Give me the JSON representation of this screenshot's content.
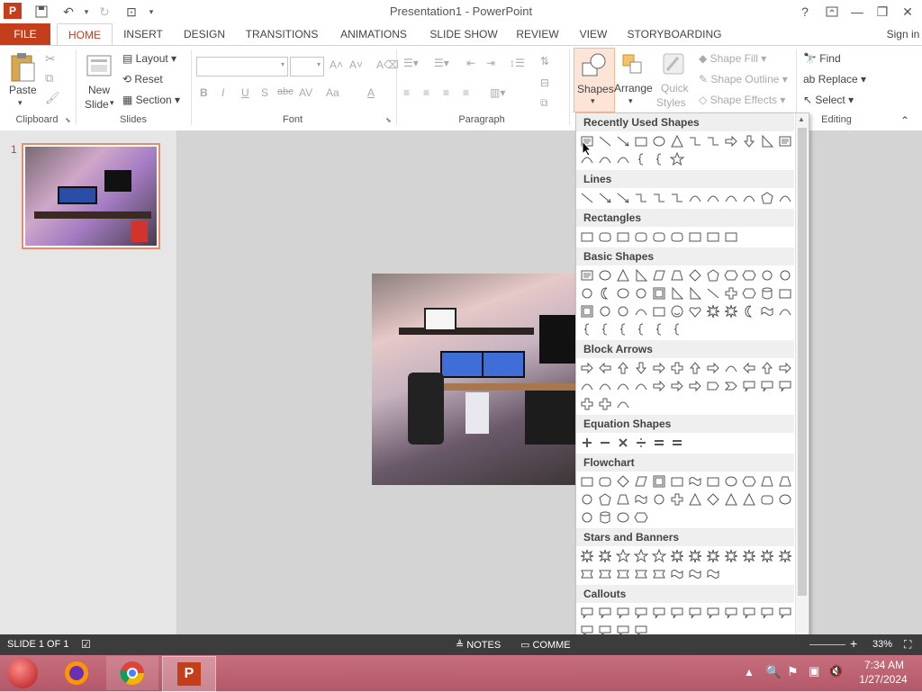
{
  "app": {
    "title": "Presentation1 - PowerPoint",
    "sign_in": "Sign in"
  },
  "tabs": [
    "FILE",
    "HOME",
    "INSERT",
    "DESIGN",
    "TRANSITIONS",
    "ANIMATIONS",
    "SLIDE SHOW",
    "REVIEW",
    "VIEW",
    "STORYBOARDING"
  ],
  "ribbon": {
    "clipboard": {
      "label": "Clipboard",
      "paste": "Paste"
    },
    "slides": {
      "label": "Slides",
      "new_slide_1": "New",
      "new_slide_2": "Slide",
      "layout": "Layout",
      "reset": "Reset",
      "section": "Section"
    },
    "font": {
      "label": "Font",
      "bold": "B",
      "italic": "I",
      "underline": "U",
      "shadow": "S",
      "strike": "abc",
      "spacing": "AV",
      "case": "Aa",
      "color": "A"
    },
    "paragraph": {
      "label": "Paragraph"
    },
    "drawing": {
      "shapes": "Shapes",
      "arrange": "Arrange",
      "quick_styles_1": "Quick",
      "quick_styles_2": "Styles",
      "shape_fill": "Shape Fill",
      "shape_outline": "Shape Outline",
      "shape_effects": "Shape Effects"
    },
    "editing": {
      "label": "Editing",
      "find": "Find",
      "replace": "Replace",
      "select": "Select"
    }
  },
  "thumbnails": [
    {
      "number": "1"
    }
  ],
  "dropdown": {
    "sections": [
      "Recently Used Shapes",
      "Lines",
      "Rectangles",
      "Basic Shapes",
      "Block Arrows",
      "Equation Shapes",
      "Flowchart",
      "Stars and Banners",
      "Callouts"
    ]
  },
  "statusbar": {
    "slide": "SLIDE 1 OF 1",
    "notes": "NOTES",
    "comments": "COMME",
    "zoom": "33%"
  },
  "taskbar": {
    "time": "7:34 AM",
    "date": "1/27/2024"
  },
  "colors": {
    "accent": "#c43e1c",
    "statusbar": "#3c3c3c",
    "taskbar": "#b35868"
  }
}
